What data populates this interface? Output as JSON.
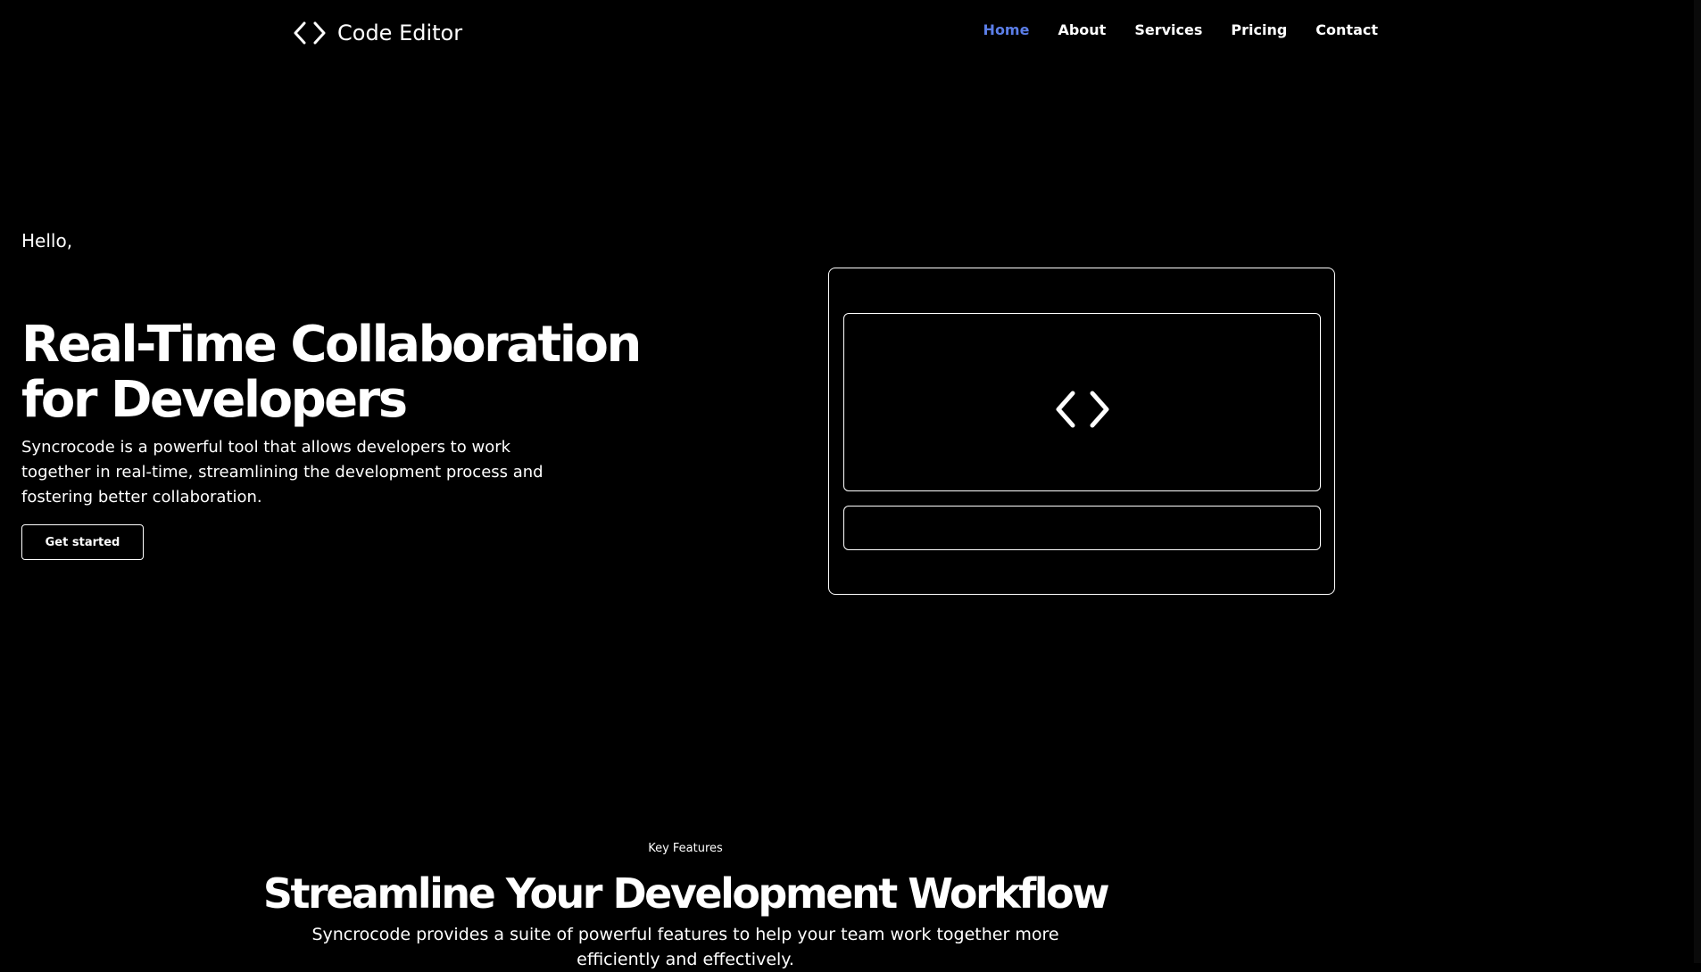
{
  "nav": {
    "logo_text": "Code Editor",
    "logo_icon": "code-brackets-icon",
    "links": [
      {
        "label": "Home",
        "active": true
      },
      {
        "label": "About",
        "active": false
      },
      {
        "label": "Services",
        "active": false
      },
      {
        "label": "Pricing",
        "active": false
      },
      {
        "label": "Contact",
        "active": false
      }
    ],
    "active_color": "#5b7ee8"
  },
  "hero": {
    "greeting": "Hello,",
    "title": "Real-Time Collaboration for Developers",
    "description": "Syncrocode is a powerful tool that allows developers to work together in real-time, streamlining the development process and fostering better collaboration.",
    "cta_label": "Get started",
    "illustration_icon": "code-brackets-icon"
  },
  "features": {
    "eyebrow": "Key Features",
    "title": "Streamline Your Development Workflow",
    "description": "Syncrocode provides a suite of powerful features to help your team work together more efficiently and effectively."
  },
  "colors": {
    "background": "#000000",
    "text": "#ffffff",
    "accent": "#5b7ee8"
  }
}
